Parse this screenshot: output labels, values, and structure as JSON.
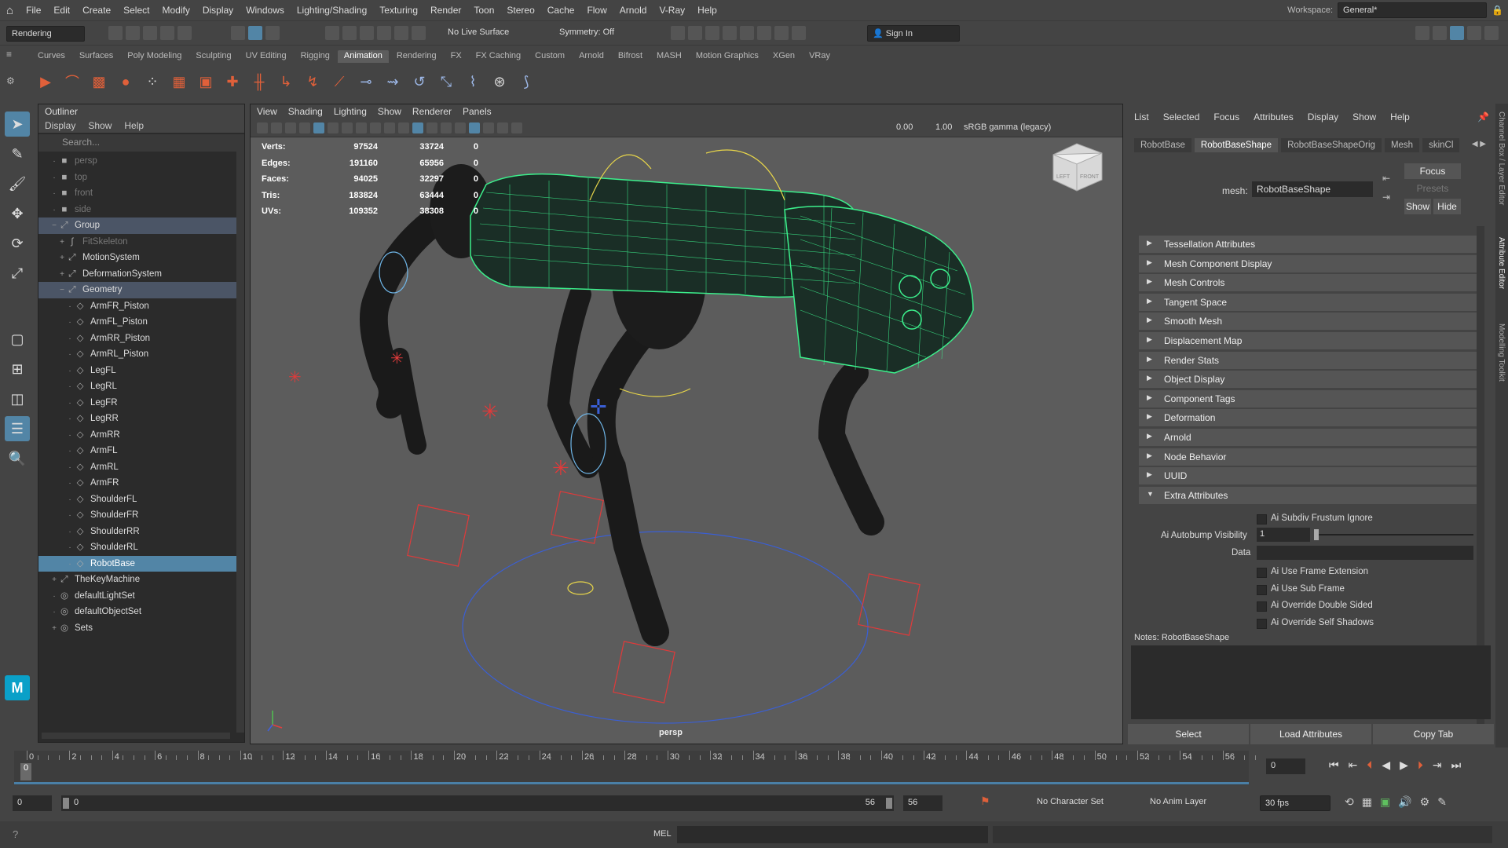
{
  "menu": [
    "File",
    "Edit",
    "Create",
    "Select",
    "Modify",
    "Display",
    "Windows",
    "Lighting/Shading",
    "Texturing",
    "Render",
    "Toon",
    "Stereo",
    "Cache",
    "Flow",
    "Arnold",
    "V-Ray",
    "Help"
  ],
  "workspace": {
    "label": "Workspace:",
    "value": "General*"
  },
  "status": {
    "mode": "Rendering",
    "live_surface": "No Live Surface",
    "symmetry": "Symmetry: Off",
    "sign_in": "Sign In"
  },
  "shelf_tabs": [
    "Curves",
    "Surfaces",
    "Poly Modeling",
    "Sculpting",
    "UV Editing",
    "Rigging",
    "Animation",
    "Rendering",
    "FX",
    "FX Caching",
    "Custom",
    "Arnold",
    "Bifrost",
    "MASH",
    "Motion Graphics",
    "XGen",
    "VRay"
  ],
  "shelf_active": "Animation",
  "outliner": {
    "title": "Outliner",
    "menu": [
      "Display",
      "Show",
      "Help"
    ],
    "search_placeholder": "Search...",
    "items": [
      {
        "label": "persp",
        "icon": "camera-icon",
        "indent": 1,
        "dim": true
      },
      {
        "label": "top",
        "icon": "camera-icon",
        "indent": 1,
        "dim": true
      },
      {
        "label": "front",
        "icon": "camera-icon",
        "indent": 1,
        "dim": true
      },
      {
        "label": "side",
        "icon": "camera-icon",
        "indent": 1,
        "dim": true
      },
      {
        "label": "Group",
        "icon": "transform-icon",
        "indent": 1,
        "exp": "−",
        "hl": true
      },
      {
        "label": "FitSkeleton",
        "icon": "joint-icon",
        "indent": 2,
        "exp": "+",
        "dim": true
      },
      {
        "label": "MotionSystem",
        "icon": "transform-icon",
        "indent": 2,
        "exp": "+"
      },
      {
        "label": "DeformationSystem",
        "icon": "transform-icon",
        "indent": 2,
        "exp": "+"
      },
      {
        "label": "Geometry",
        "icon": "transform-icon",
        "indent": 2,
        "exp": "−",
        "hl": true
      },
      {
        "label": "ArmFR_Piston",
        "icon": "mesh-icon",
        "indent": 3
      },
      {
        "label": "ArmFL_Piston",
        "icon": "mesh-icon",
        "indent": 3
      },
      {
        "label": "ArmRR_Piston",
        "icon": "mesh-icon",
        "indent": 3
      },
      {
        "label": "ArmRL_Piston",
        "icon": "mesh-icon",
        "indent": 3
      },
      {
        "label": "LegFL",
        "icon": "mesh-icon",
        "indent": 3
      },
      {
        "label": "LegRL",
        "icon": "mesh-icon",
        "indent": 3
      },
      {
        "label": "LegFR",
        "icon": "mesh-icon",
        "indent": 3
      },
      {
        "label": "LegRR",
        "icon": "mesh-icon",
        "indent": 3
      },
      {
        "label": "ArmRR",
        "icon": "mesh-icon",
        "indent": 3
      },
      {
        "label": "ArmFL",
        "icon": "mesh-icon",
        "indent": 3
      },
      {
        "label": "ArmRL",
        "icon": "mesh-icon",
        "indent": 3
      },
      {
        "label": "ArmFR",
        "icon": "mesh-icon",
        "indent": 3
      },
      {
        "label": "ShoulderFL",
        "icon": "mesh-icon",
        "indent": 3
      },
      {
        "label": "ShoulderFR",
        "icon": "mesh-icon",
        "indent": 3
      },
      {
        "label": "ShoulderRR",
        "icon": "mesh-icon",
        "indent": 3
      },
      {
        "label": "ShoulderRL",
        "icon": "mesh-icon",
        "indent": 3
      },
      {
        "label": "RobotBase",
        "icon": "mesh-icon",
        "indent": 3,
        "sel": true
      },
      {
        "label": "TheKeyMachine",
        "icon": "transform-icon",
        "indent": 1,
        "exp": "+"
      },
      {
        "label": "defaultLightSet",
        "icon": "set-icon",
        "indent": 1
      },
      {
        "label": "defaultObjectSet",
        "icon": "set-icon",
        "indent": 1
      },
      {
        "label": "Sets",
        "icon": "set-icon",
        "indent": 1,
        "exp": "+"
      }
    ]
  },
  "viewport": {
    "menu": [
      "View",
      "Shading",
      "Lighting",
      "Show",
      "Renderer",
      "Panels"
    ],
    "exposure": "0.00",
    "gamma": "1.00",
    "colorspace": "sRGB gamma (legacy)",
    "camera": "persp",
    "hud": [
      {
        "label": "Verts:",
        "a": "97524",
        "b": "33724",
        "c": "0"
      },
      {
        "label": "Edges:",
        "a": "191160",
        "b": "65956",
        "c": "0"
      },
      {
        "label": "Faces:",
        "a": "94025",
        "b": "32297",
        "c": "0"
      },
      {
        "label": "Tris:",
        "a": "183824",
        "b": "63444",
        "c": "0"
      },
      {
        "label": "UVs:",
        "a": "109352",
        "b": "38308",
        "c": "0"
      }
    ],
    "cube_left": "LEFT",
    "cube_front": "FRONT"
  },
  "ae": {
    "menu": [
      "List",
      "Selected",
      "Focus",
      "Attributes",
      "Display",
      "Show",
      "Help"
    ],
    "tabs": [
      "RobotBase",
      "RobotBaseShape",
      "RobotBaseShapeOrig",
      "Mesh",
      "skinCl"
    ],
    "active_tab": "RobotBaseShape",
    "mesh_label": "mesh:",
    "mesh_value": "RobotBaseShape",
    "focus": "Focus",
    "presets": "Presets",
    "show": "Show",
    "hide": "Hide",
    "sections": [
      "Tessellation Attributes",
      "Mesh Component Display",
      "Mesh Controls",
      "Tangent Space",
      "Smooth Mesh",
      "Displacement Map",
      "Render Stats",
      "Object Display",
      "Component Tags",
      "Deformation",
      "Arnold",
      "Node Behavior",
      "UUID",
      "Extra Attributes"
    ],
    "extra": {
      "subdiv_frustum": "Ai Subdiv Frustum Ignore",
      "autobump_label": "Ai Autobump Visibility",
      "autobump_value": "1",
      "data_label": "Data",
      "frame_ext": "Ai Use Frame Extension",
      "sub_frame": "Ai Use Sub Frame",
      "double_sided": "Ai Override Double Sided",
      "self_shadows": "Ai Override Self Shadows"
    },
    "notes": "Notes:  RobotBaseShape",
    "buttons": [
      "Select",
      "Load Attributes",
      "Copy Tab"
    ]
  },
  "right_dock": [
    "Channel Box / Layer Editor",
    "Attribute Editor",
    "Modelling Toolkit"
  ],
  "timeline": {
    "ticks": [
      "0",
      "2",
      "4",
      "6",
      "8",
      "10",
      "12",
      "14",
      "16",
      "18",
      "20",
      "22",
      "24",
      "26",
      "28",
      "30",
      "32",
      "34",
      "36",
      "38",
      "40",
      "42",
      "44",
      "46",
      "48",
      "50",
      "52",
      "54",
      "56"
    ],
    "current": "0",
    "current_field": "0"
  },
  "range": {
    "start": "0",
    "inner_start": "0",
    "inner_end": "56",
    "end": "56",
    "character_set": "No Character Set",
    "anim_layer": "No Anim Layer",
    "fps": "30 fps"
  },
  "cmd": {
    "label": "MEL"
  },
  "colors": {
    "accent": "#5285a6",
    "wire": "#3cf08c"
  }
}
